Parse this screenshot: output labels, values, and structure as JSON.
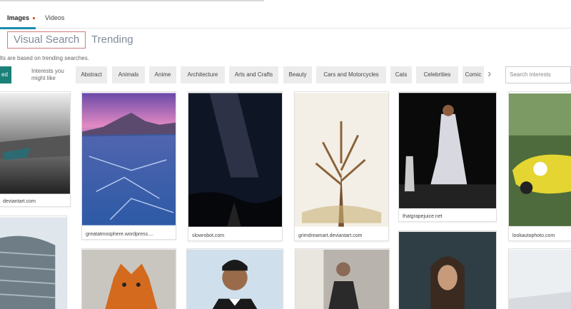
{
  "tabs": {
    "images": "Images",
    "videos": "Videos"
  },
  "subtabs": {
    "visual_search": "Visual Search",
    "trending": "Trending"
  },
  "note": "lts are based on trending searches.",
  "chips": {
    "selected": "ed",
    "interests_label": "Interests you might like",
    "items": [
      "Abstract",
      "Animals",
      "Anime",
      "Architecture",
      "Arts and Crafts",
      "Beauty",
      "Cars and Motorcycles",
      "Cats",
      "Celebrities",
      "Comic"
    ]
  },
  "search": {
    "placeholder": "Search interests"
  },
  "cards": [
    {
      "caption": "deviantart.com"
    },
    {
      "caption": "greatatmosphere.wordpress...."
    },
    {
      "caption": "slowrobot.com"
    },
    {
      "caption": "grimdreamart.deviantart.com"
    },
    {
      "caption": "thatgrapejuice.net"
    },
    {
      "caption": "lookautophoto.com"
    }
  ],
  "colors": {
    "accent": "#1b8077",
    "tab_underline": "#1b8cae",
    "vs_border": "#d07b7b"
  }
}
